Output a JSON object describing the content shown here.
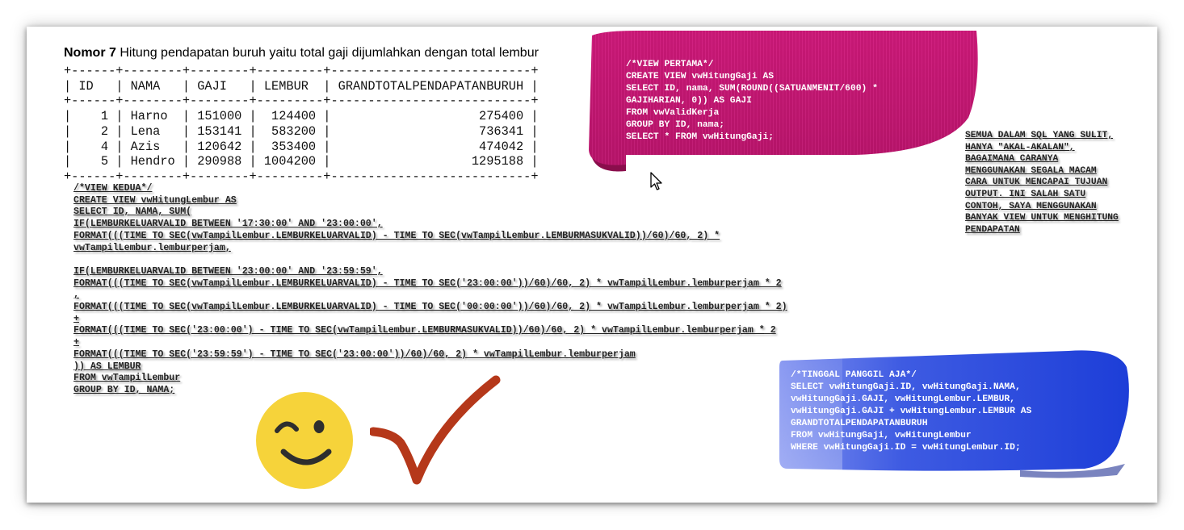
{
  "heading": {
    "number": "Nomor 7",
    "text": " Hitung pendapatan buruh yaitu total gaji dijumlahkan dengan total lembur"
  },
  "result_table": {
    "text": "+------+--------+--------+---------+---------------------------+\n| ID   | NAMA   | GAJI   | LEMBUR  | GRANDTOTALPENDAPATANBURUH |\n+------+--------+--------+---------+---------------------------+\n|    1 | Harno  | 151000 |  124400 |                    275400 |\n|    2 | Lena   | 153141 |  583200 |                    736341 |\n|    4 | Azis   | 120642 |  353400 |                    474042 |\n|    5 | Hendro | 290988 | 1004200 |                   1295188 |\n+------+--------+--------+---------+---------------------------+",
    "columns": [
      "ID",
      "NAMA",
      "GAJI",
      "LEMBUR",
      "GRANDTOTALPENDAPATANBURUH"
    ],
    "rows": [
      [
        "1",
        "Harno",
        "151000",
        "124400",
        "275400"
      ],
      [
        "2",
        "Lena",
        "153141",
        "583200",
        "736341"
      ],
      [
        "4",
        "Azis",
        "120642",
        "353400",
        "474042"
      ],
      [
        "5",
        "Hendro",
        "290988",
        "1004200",
        "1295188"
      ]
    ]
  },
  "view_pertama": {
    "code": "/*VIEW PERTAMA*/\nCREATE VIEW vwHitungGaji AS\nSELECT ID, nama, SUM(ROUND((SATUANMENIT/600) *\nGAJIHARIAN, 0)) AS GAJI\nFROM vwValidKerja\nGROUP BY ID, nama;\nSELECT * FROM vwHitungGaji;"
  },
  "note": {
    "text": "SEMUA DALAM SQL YANG SULIT,\nHANYA \"AKAL-AKALAN\",\nBAGAIMANA CARANYA\nMENGGUNAKAN SEGALA MACAM\nCARA UNTUK MENCAPAI TUJUAN\nOUTPUT. INI SALAH SATU\nCONTOH, SAYA MENGGUNAKAN\nBANYAK VIEW UNTUK MENGHITUNG\nPENDAPATAN"
  },
  "view_kedua": {
    "code": "/*VIEW KEDUA*/\nCREATE VIEW vwHitungLembur AS\nSELECT ID, NAMA, SUM(\nIF(LEMBURKELUARVALID BETWEEN '17:30:00' AND '23:00:00',\nFORMAT(((TIME TO SEC(vwTampilLembur.LEMBURKELUARVALID) - TIME TO SEC(vwTampilLembur.LEMBURMASUKVALID))/60)/60, 2) *\nvwTampilLembur.lemburperjam,\n\nIF(LEMBURKELUARVALID BETWEEN '23:00:00' AND '23:59:59',\nFORMAT(((TIME TO SEC(vwTampilLembur.LEMBURKELUARVALID) - TIME TO SEC('23:00:00'))/60)/60, 2) * vwTampilLembur.lemburperjam * 2\n,\nFORMAT(((TIME TO SEC(vwTampilLembur.LEMBURKELUARVALID) - TIME TO SEC('00:00:00'))/60)/60, 2) * vwTampilLembur.lemburperjam * 2)\n+\nFORMAT(((TIME TO SEC('23:00:00') - TIME TO SEC(vwTampilLembur.LEMBURMASUKVALID))/60)/60, 2) * vwTampilLembur.lemburperjam * 2\n+\nFORMAT(((TIME TO SEC('23:59:59') - TIME TO SEC('23:00:00'))/60)/60, 2) * vwTampilLembur.lemburperjam\n)) AS LEMBUR\nFROM vwTampilLembur\nGROUP BY ID, NAMA;"
  },
  "tinggal_panggil": {
    "code": "/*TINGGAL PANGGIL AJA*/\nSELECT vwHitungGaji.ID, vwHitungGaji.NAMA,\nvwHitungGaji.GAJI, vwHitungLembur.LEMBUR,\nvwHitungGaji.GAJI + vwHitungLembur.LEMBUR AS\nGRANDTOTALPENDAPATANBURUH\nFROM vwHitungGaji, vwHitungLembur\nWHERE vwHitungGaji.ID = vwHitungLembur.ID;"
  },
  "icons": {
    "smiley": "winking-smiley-icon",
    "check": "checkmark-icon",
    "cursor": "mouse-pointer-icon"
  },
  "colors": {
    "pink_ribbon": "#c0166f",
    "blue_ribbon": "#2342d6",
    "smiley": "#f6d33a",
    "check": "#b5381a"
  }
}
